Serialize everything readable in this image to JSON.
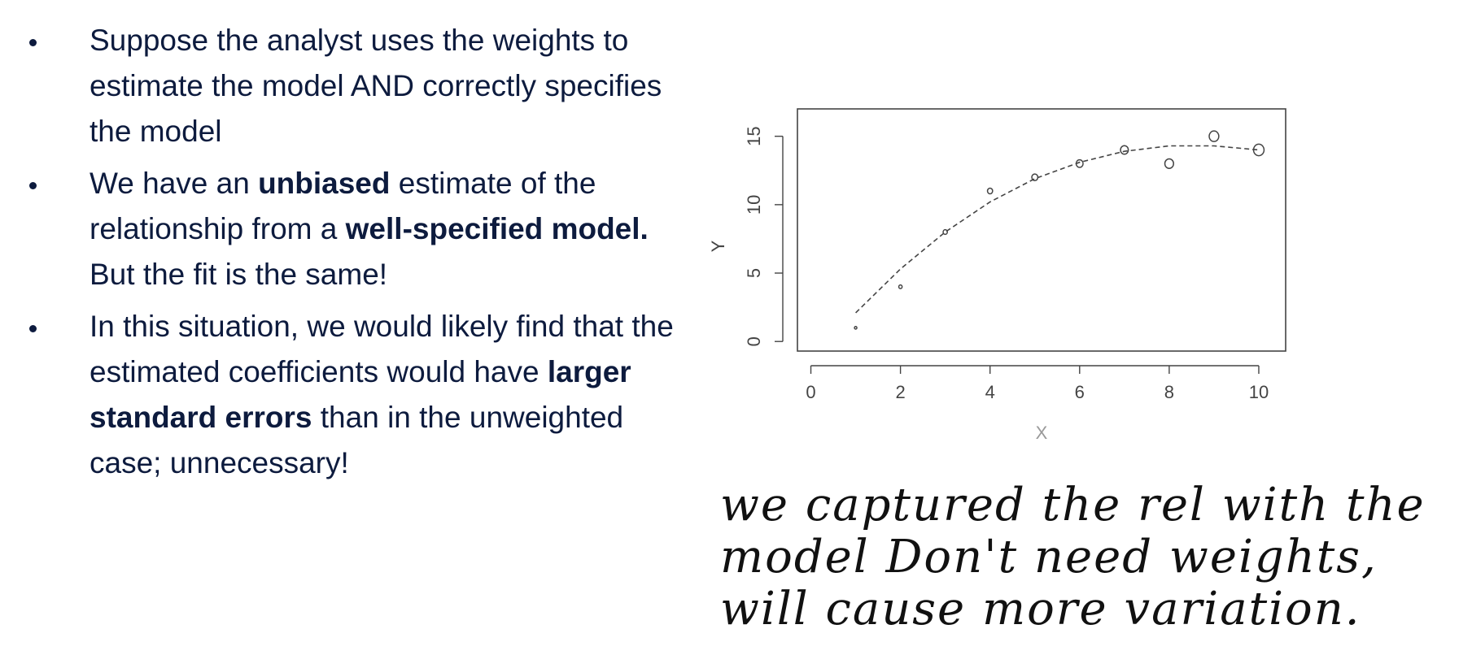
{
  "bullets": [
    {
      "segments": [
        {
          "text": "Suppose the analyst uses the weights to estimate the model AND correctly specifies the model",
          "bold": false
        }
      ]
    },
    {
      "segments": [
        {
          "text": "We have an ",
          "bold": false
        },
        {
          "text": "unbiased",
          "bold": true
        },
        {
          "text": " estimate of the relationship from a ",
          "bold": false
        },
        {
          "text": "well-specified model.",
          "bold": true
        },
        {
          "text": " But the fit is the same!",
          "bold": false
        }
      ]
    },
    {
      "segments": [
        {
          "text": "In this situation, we would likely find that the estimated coefficients would have ",
          "bold": false
        },
        {
          "text": "larger standard errors",
          "bold": true
        },
        {
          "text": " than in the unweighted case; unnecessary!",
          "bold": false
        }
      ]
    }
  ],
  "chart_data": {
    "type": "scatter",
    "xlabel": "X",
    "ylabel": "Y",
    "x_ticks": [
      0,
      2,
      4,
      6,
      8,
      10
    ],
    "y_ticks": [
      0,
      5,
      10,
      15
    ],
    "xlim": [
      -0.3,
      10.6
    ],
    "ylim": [
      -0.7,
      17
    ],
    "grid": false,
    "points": [
      {
        "x": 1,
        "y": 1
      },
      {
        "x": 2,
        "y": 4
      },
      {
        "x": 3,
        "y": 8
      },
      {
        "x": 4,
        "y": 11
      },
      {
        "x": 5,
        "y": 12
      },
      {
        "x": 6,
        "y": 13
      },
      {
        "x": 7,
        "y": 14
      },
      {
        "x": 8,
        "y": 13
      },
      {
        "x": 9,
        "y": 15
      },
      {
        "x": 10,
        "y": 14
      }
    ],
    "fit_line": {
      "style": "dashed",
      "x": [
        1,
        2,
        3,
        4,
        5,
        6,
        7,
        8,
        9,
        10
      ],
      "y": [
        2.1,
        5.3,
        8.0,
        10.2,
        11.9,
        13.1,
        13.9,
        14.3,
        14.3,
        14.0
      ]
    }
  },
  "handwriting": {
    "lines": [
      "we captured the rel with the",
      "model Don't need weights,",
      "will cause more variation."
    ]
  },
  "colors": {
    "text": "#0d1b3e",
    "axis": "#444444",
    "points": "#444444"
  }
}
